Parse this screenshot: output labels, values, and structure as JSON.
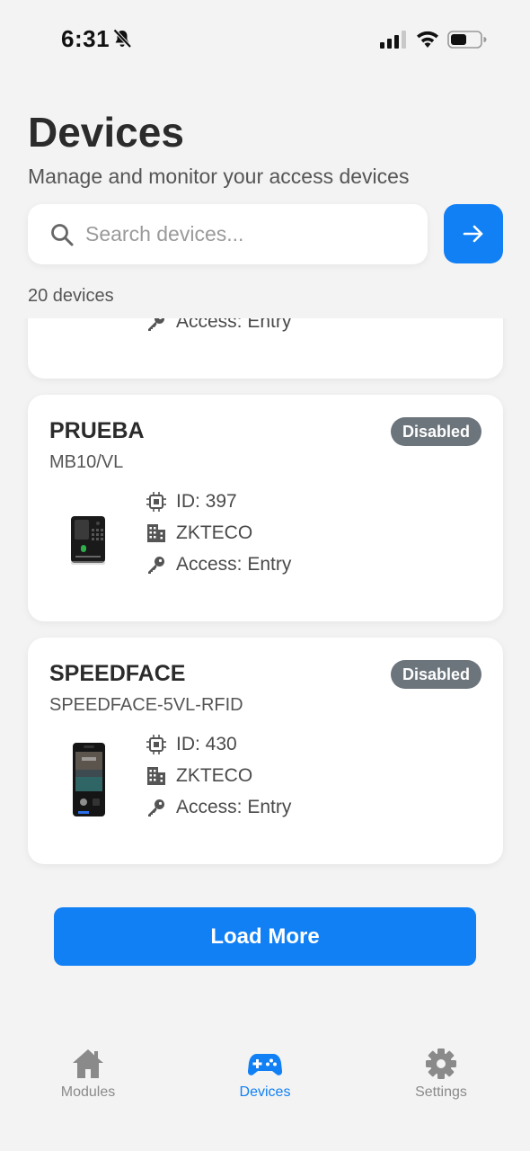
{
  "status_bar": {
    "time": "6:31"
  },
  "header": {
    "title": "Devices",
    "subtitle": "Manage and monitor your access devices"
  },
  "search": {
    "placeholder": "Search devices...",
    "value": ""
  },
  "device_count": "20 devices",
  "devices": [
    {
      "access": "Access: Entry"
    },
    {
      "name": "PRUEBA",
      "model": "MB10/VL",
      "status": "Disabled",
      "id": "ID: 397",
      "brand": "ZKTECO",
      "access": "Access: Entry"
    },
    {
      "name": "SPEEDFACE",
      "model": "SPEEDFACE-5VL-RFID",
      "status": "Disabled",
      "id": "ID: 430",
      "brand": "ZKTECO",
      "access": "Access: Entry"
    }
  ],
  "load_more_label": "Load More",
  "tabs": [
    {
      "label": "Modules",
      "icon": "home-icon",
      "active": false
    },
    {
      "label": "Devices",
      "icon": "gamepad-icon",
      "active": true
    },
    {
      "label": "Settings",
      "icon": "gear-icon",
      "active": false
    }
  ],
  "colors": {
    "accent": "#1180f5",
    "badge": "#6c747c",
    "background": "#f3f3f3"
  }
}
